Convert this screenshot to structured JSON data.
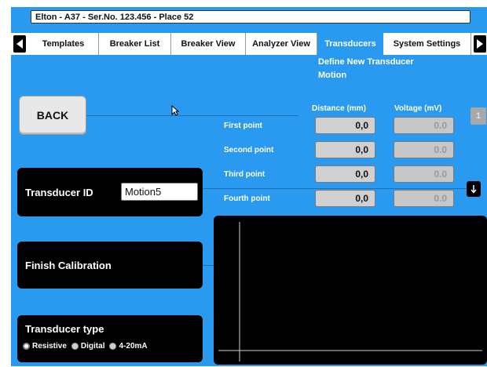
{
  "title_bar": {
    "text": "Elton - A37 - Ser.No. 123.456 - Place 52"
  },
  "tabs": [
    {
      "label": "Templates",
      "active": false
    },
    {
      "label": "Breaker List",
      "active": false
    },
    {
      "label": "Breaker View",
      "active": false
    },
    {
      "label": "Analyzer View",
      "active": false
    },
    {
      "label": "Transducers",
      "active": true
    },
    {
      "label": "System Settings",
      "active": false
    }
  ],
  "subheading": {
    "line1": "Define New Transducer",
    "line2": "Motion"
  },
  "back_button": {
    "label": "BACK"
  },
  "table": {
    "headers": {
      "distance": "Distance (mm)",
      "voltage": "Voltage (mV)"
    },
    "rows": [
      {
        "label": "First point",
        "distance": "0,0",
        "voltage": "0.0"
      },
      {
        "label": "Second point",
        "distance": "0,0",
        "voltage": "0.0"
      },
      {
        "label": "Third point",
        "distance": "0,0",
        "voltage": "0.0"
      },
      {
        "label": "Fourth point",
        "distance": "0,0",
        "voltage": "0.0"
      }
    ]
  },
  "side_button": {
    "label": "1"
  },
  "transducer_id": {
    "label": "Transducer ID",
    "value": "Motion5"
  },
  "finish_calibration": {
    "label": "Finish Calibration"
  },
  "transducer_type": {
    "label": "Transducer type",
    "options": [
      {
        "label": "Resistive",
        "selected": true
      },
      {
        "label": "Digital",
        "selected": false
      },
      {
        "label": "4-20mA",
        "selected": false
      }
    ]
  },
  "colors": {
    "background": "#2a9af0",
    "panel": "#000000",
    "button": "#e8e8e8"
  },
  "icons": {
    "left_arrow": "triangle-left-icon",
    "right_arrow": "triangle-right-icon",
    "down_arrow": "arrow-down-icon",
    "cursor": "mouse-pointer-icon"
  }
}
